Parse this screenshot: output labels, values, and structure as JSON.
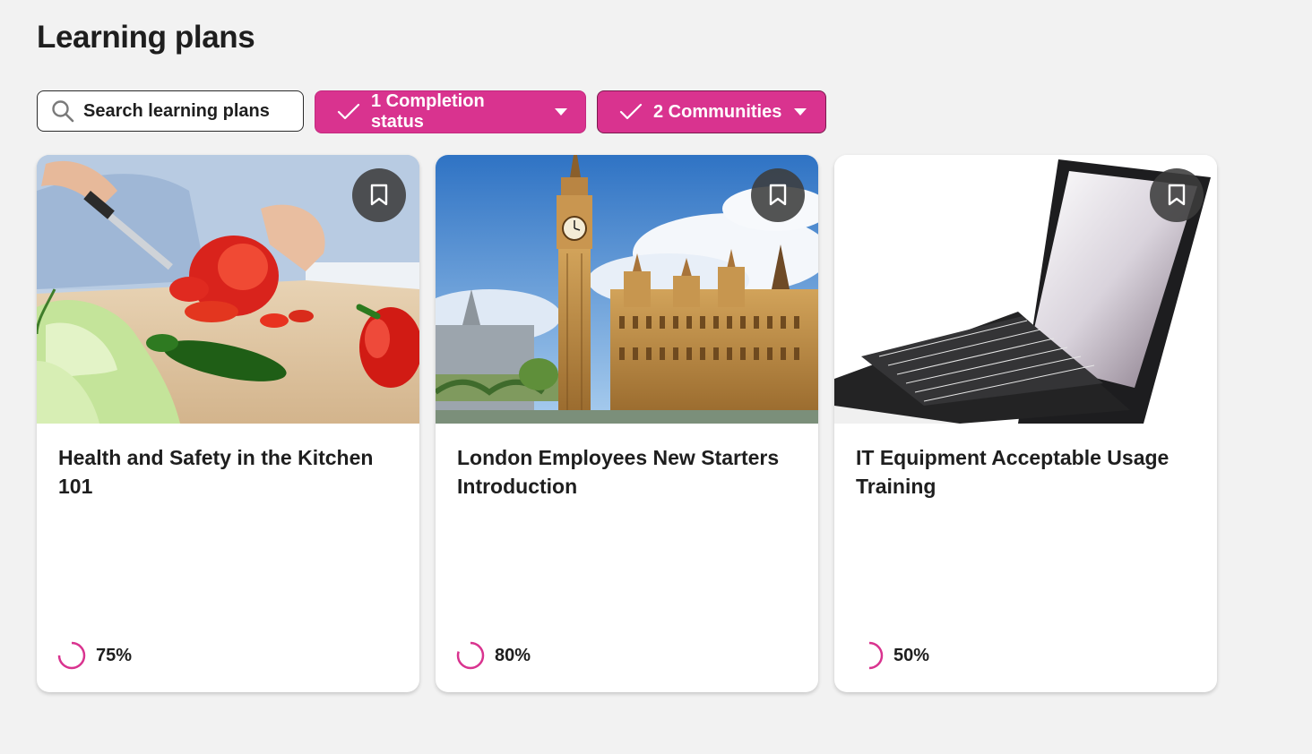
{
  "page": {
    "title": "Learning plans"
  },
  "filters": {
    "search_placeholder": "Search learning plans",
    "search_icon": "search-icon",
    "completion_label": "1 Completion status",
    "communities_label": "2 Communities",
    "chip_icon": "check-icon",
    "chip_dropdown_icon": "caret-down-icon"
  },
  "colors": {
    "accent": "#d9338f",
    "background": "#f2f2f2",
    "card": "#ffffff",
    "bookmark_button": "#3c3c3c"
  },
  "plans": [
    {
      "title": "Health and Safety in the Kitchen 101",
      "image": "kitchen-vegetables-image",
      "progress_label": "75%",
      "progress": 0.75
    },
    {
      "title": "London Employees New Starters Introduction",
      "image": "big-ben-parliament-image",
      "progress_label": "80%",
      "progress": 0.8
    },
    {
      "title": "IT Equipment Acceptable Usage Training",
      "image": "laptop-image",
      "progress_label": "50%",
      "progress": 0.5
    }
  ]
}
